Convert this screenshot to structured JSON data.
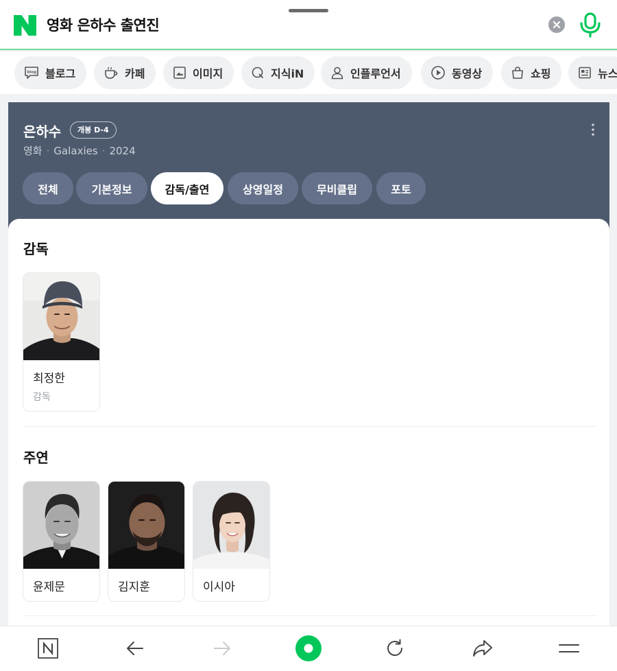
{
  "search": {
    "query": "영화 은하수 출연진"
  },
  "chips": [
    {
      "label": "블로그",
      "icon": "blog-icon"
    },
    {
      "label": "카페",
      "icon": "cup-icon"
    },
    {
      "label": "이미지",
      "icon": "image-icon"
    },
    {
      "label": "지식iN",
      "icon": "q-icon"
    },
    {
      "label": "인플루언서",
      "icon": "person-icon"
    },
    {
      "label": "동영상",
      "icon": "play-icon"
    },
    {
      "label": "쇼핑",
      "icon": "shopping-bag-icon"
    },
    {
      "label": "뉴스",
      "icon": "news-icon"
    }
  ],
  "movie": {
    "title": "은하수",
    "badge": "개봉 D-4",
    "meta": {
      "type": "영화",
      "english_title": "Galaxies",
      "year": "2024"
    },
    "tabs": [
      "전체",
      "기본정보",
      "감독/출연",
      "상영일정",
      "무비클립",
      "포토"
    ],
    "active_tab": "감독/출연"
  },
  "director_section": {
    "title": "감독",
    "people": [
      {
        "name": "최정한",
        "role": "감독"
      }
    ]
  },
  "cast_section": {
    "title": "주연",
    "people": [
      {
        "name": "윤제문"
      },
      {
        "name": "김지훈"
      },
      {
        "name": "이시아"
      }
    ]
  },
  "toolbar": {
    "buttons": [
      "naver-home-icon",
      "back-icon",
      "forward-icon",
      "green-dot-icon",
      "refresh-icon",
      "share-icon",
      "menu-icon"
    ]
  },
  "colors": {
    "brand_green": "#03c75a",
    "card_bg": "#4d5a6e"
  }
}
